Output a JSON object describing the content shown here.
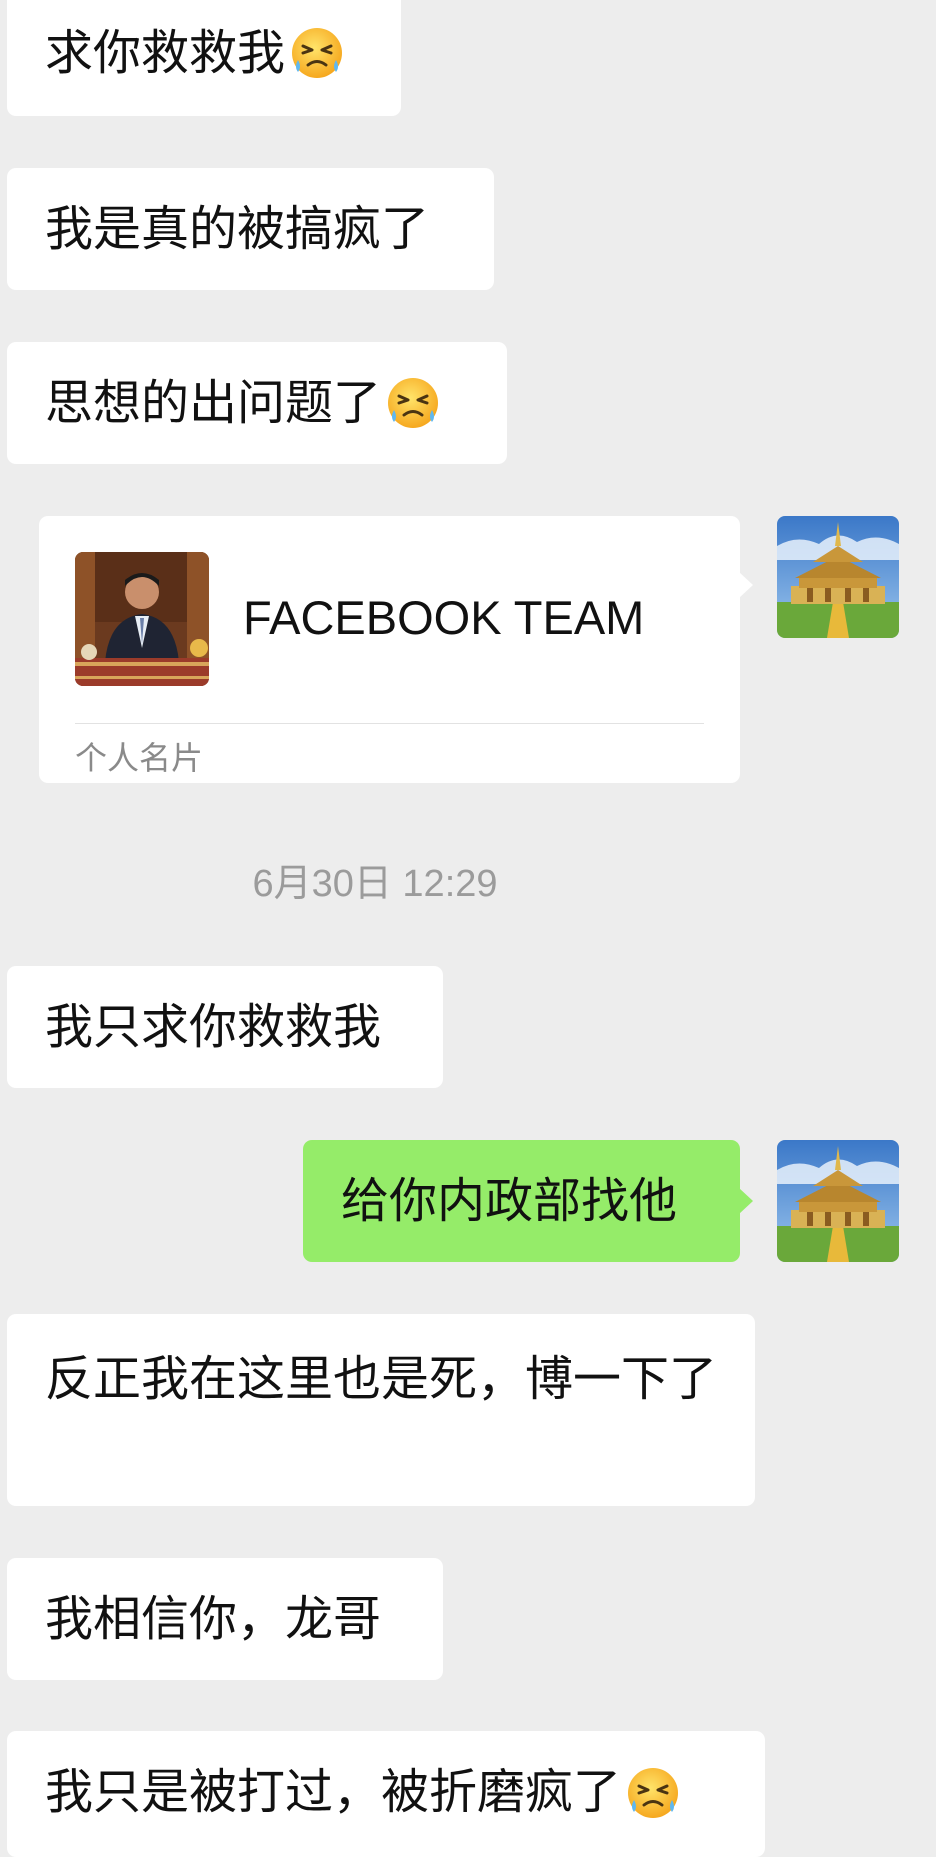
{
  "messages": {
    "m1": "求你救救我",
    "m2": "我是真的被搞疯了",
    "m3": "思想的出问题了",
    "card": {
      "name": "FACEBOOK TEAM",
      "footer": "个人名片"
    },
    "timestamp": "6月30日 12:29",
    "m4": "我只求你救救我",
    "m5": "给你内政部找他",
    "m6": "反正我在这里也是死，博一下了",
    "m7": "我相信你，龙哥",
    "m8": "我只是被打过，被折磨疯了"
  },
  "icons": {
    "emoji": "grimacing-tears-emoji-icon",
    "avatar": "palace-avatar",
    "card_photo": "man-in-suit-photo"
  },
  "colors": {
    "background": "#ededed",
    "bubble_incoming": "#ffffff",
    "bubble_outgoing": "#95ec69"
  }
}
